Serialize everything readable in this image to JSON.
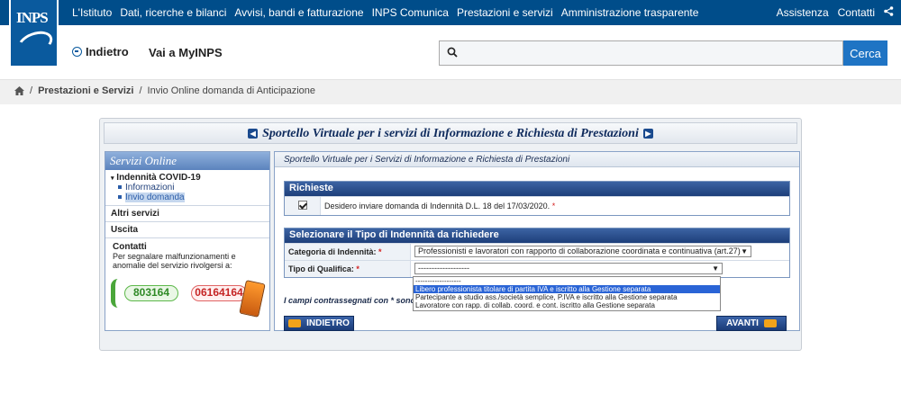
{
  "brand": {
    "logo_text": "INPS"
  },
  "topnav": {
    "items": [
      "L'Istituto",
      "Dati, ricerche e bilanci",
      "Avvisi, bandi e fatturazione",
      "INPS Comunica",
      "Prestazioni e servizi",
      "Amministrazione trasparente"
    ],
    "right": [
      "Assistenza",
      "Contatti"
    ]
  },
  "header": {
    "back_label": "Indietro",
    "myinps_label": "Vai a MyINPS",
    "search_placeholder": "",
    "search_button": "Cerca"
  },
  "breadcrumb": {
    "items": [
      "Prestazioni e Servizi",
      "Invio Online domanda di Anticipazione"
    ]
  },
  "panel": {
    "title": "Sportello Virtuale per i servizi di Informazione e Richiesta di Prestazioni"
  },
  "sidebar": {
    "heading": "Servizi Online",
    "group": {
      "title": "Indennità COVID-19",
      "items": [
        "Informazioni",
        "Invio domanda"
      ]
    },
    "other": "Altri servizi",
    "exit": "Uscita",
    "contact_title": "Contatti",
    "contact_text": "Per segnalare malfunzionamenti e anomalie del servizio rivolgersi a:",
    "phone_green": "803164",
    "phone_red": "06164164"
  },
  "content": {
    "header": "Sportello Virtuale per i Servizi di Informazione e Richiesta di Prestazioni",
    "richieste": {
      "title": "Richieste",
      "text": "Desidero inviare domanda di Indennità D.L. 18 del 17/03/2020."
    },
    "tipo": {
      "title": "Selezionare il Tipo di Indennità da richiedere",
      "categoria_label": "Categoria di Indennità:",
      "categoria_value": "Professionisti e lavoratori con rapporto di collaborazione coordinata e continuativa (art.27)",
      "qualifica_label": "Tipo di Qualifica:",
      "qualifica_value": "-------------------",
      "options": [
        "-------------------",
        "Libero professionista titolare di partita IVA e iscritto alla Gestione separata",
        "Partecipante a studio ass./società semplice, P.IVA e iscritto alla Gestione separata",
        "Lavoratore con rapp. di collab. coord. e cont. iscritto alla Gestione separata"
      ]
    },
    "note": "I campi contrassegnati con * sono obbligatori",
    "back_button": "INDIETRO",
    "next_button": "AVANTI"
  }
}
